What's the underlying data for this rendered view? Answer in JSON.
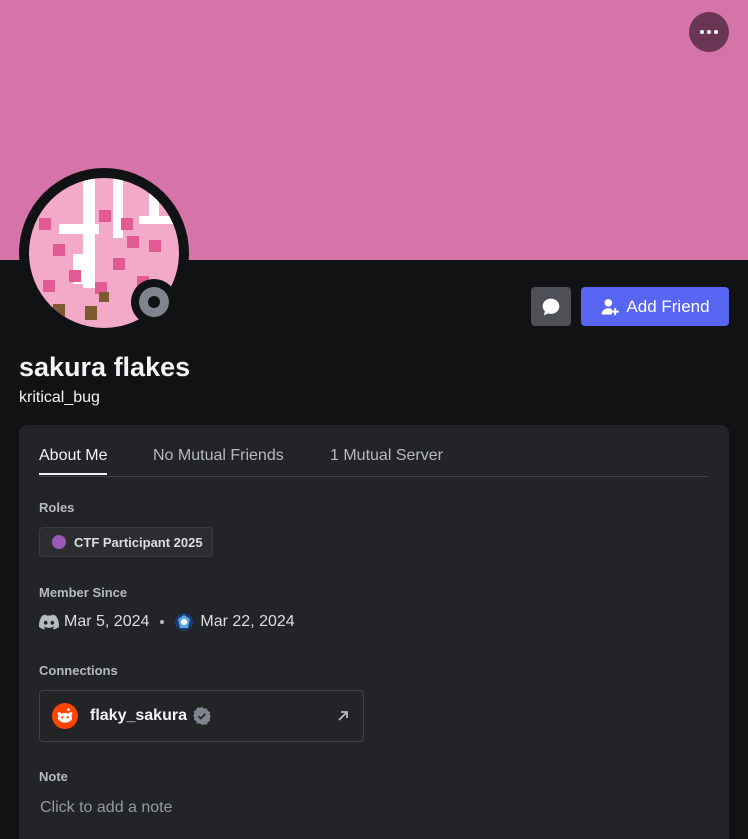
{
  "banner": {
    "color": "#d674a9"
  },
  "header": {
    "more_icon": "more-dots-icon"
  },
  "profile": {
    "display_name": "sakura flakes",
    "username": "kritical_bug",
    "status": "offline"
  },
  "actions": {
    "message_icon": "chat-bubble-icon",
    "add_friend_label": "Add Friend"
  },
  "tabs": [
    {
      "label": "About Me",
      "active": true
    },
    {
      "label": "No Mutual Friends",
      "active": false
    },
    {
      "label": "1 Mutual Server",
      "active": false
    }
  ],
  "roles": {
    "title": "Roles",
    "items": [
      {
        "label": "CTF Participant 2025",
        "color": "#9b59b6"
      }
    ]
  },
  "member_since": {
    "title": "Member Since",
    "discord_date": "Mar 5, 2024",
    "server_date": "Mar 22, 2024"
  },
  "connections": {
    "title": "Connections",
    "items": [
      {
        "service": "reddit",
        "name": "flaky_sakura",
        "verified": true
      }
    ]
  },
  "note": {
    "title": "Note",
    "placeholder": "Click to add a note"
  },
  "colors": {
    "background": "#111214",
    "card": "#232428",
    "accent": "#5865f2"
  }
}
